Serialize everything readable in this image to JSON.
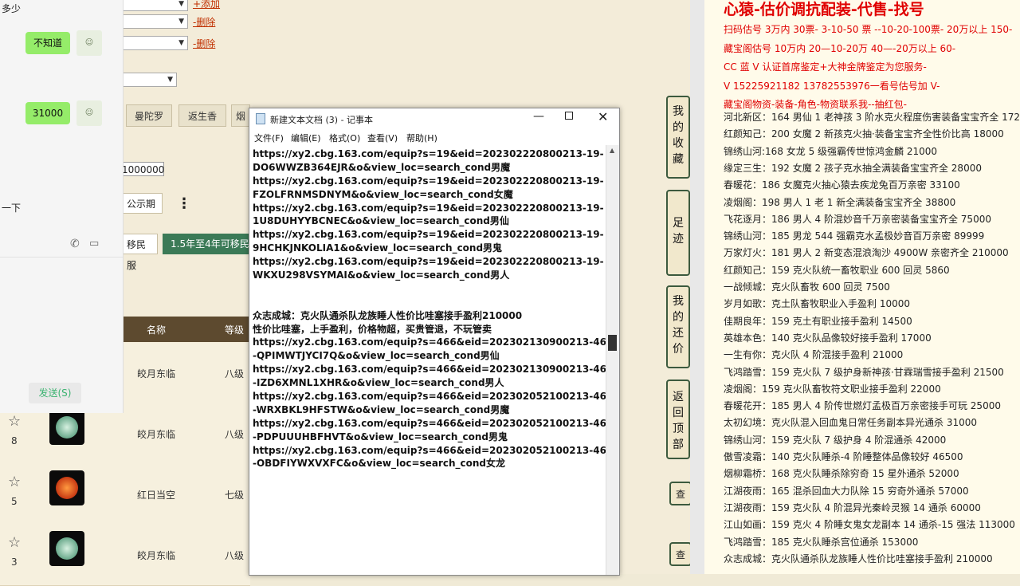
{
  "chat": {
    "top_text": "多少",
    "bubble1": "不知道",
    "bubble2": "31000",
    "left_text": "一下",
    "send_label": "发送(S)"
  },
  "game": {
    "add_link": "+添加",
    "delete1": "-删除",
    "delete2": "-删除",
    "btn_mantuoluo": "曼陀罗",
    "btn_fansheng": "返生香",
    "btn_partial": "烟",
    "price_value": "1000000",
    "public_period": "公示期",
    "migrate_label": "移民服",
    "migrate_tag": "1.5年至4年可移民",
    "col_name": "名称",
    "col_level": "等级",
    "rows": [
      {
        "idx": "",
        "name": "皎月东临",
        "level": "八级"
      },
      {
        "idx": "8",
        "name": "皎月东临",
        "level": "八级"
      },
      {
        "idx": "5",
        "name": "红日当空",
        "level": "七级"
      },
      {
        "idx": "3",
        "name": "皎月东临",
        "level": "八级"
      }
    ],
    "side_nav": [
      "我的收藏",
      "足迹",
      "我的还价",
      "返回顶部"
    ],
    "search_partial": "查"
  },
  "notepad": {
    "title": "新建文本文档 (3) - 记事本",
    "menu": [
      "文件(F)",
      "编辑(E)",
      "格式(O)",
      "查看(V)",
      "帮助(H)"
    ],
    "lines": [
      "https://xy2.cbg.163.com/equip?s=19&eid=202302220800213-19-",
      "DO6WWZB364EJR&o&view_loc=search_cond男魔",
      "https://xy2.cbg.163.com/equip?s=19&eid=202302220800213-19-",
      "FZOLFRNMSDNYM&o&view_loc=search_cond女魔",
      "https://xy2.cbg.163.com/equip?s=19&eid=202302220800213-19-",
      "1U8DUHYYBCNEC&o&view_loc=search_cond男仙",
      "https://xy2.cbg.163.com/equip?s=19&eid=202302220800213-19-",
      "9HCHKJNKOLIA1&o&view_loc=search_cond男鬼",
      "https://xy2.cbg.163.com/equip?s=19&eid=202302220800213-19-",
      "WKXU298VSYMAI&o&view_loc=search_cond男人",
      "",
      "",
      "众志成城：克火队通杀队龙族睡人性价比哇塞接手盈利210000",
      "性价比哇塞，上手盈利，价格物超，买贵管退，不玩管卖",
      "https://xy2.cbg.163.com/equip?s=466&eid=202302130900213-466",
      "-QPIMWTJYCI7Q&o&view_loc=search_cond男仙",
      "https://xy2.cbg.163.com/equip?s=466&eid=202302130900213-466",
      "-IZD6XMNL1XHR&o&view_loc=search_cond男人",
      "https://xy2.cbg.163.com/equip?s=466&eid=202302052100213-466",
      "-WRXBKL9HFSTW&o&view_loc=search_cond男魔",
      "https://xy2.cbg.163.com/equip?s=466&eid=202302052100213-466",
      "-PDPUUUHBFHVT&o&view_loc=search_cond男鬼",
      "https://xy2.cbg.163.com/equip?s=466&eid=202302052100213-466",
      "-OBDFIYWXVXFC&o&view_loc=search_cond女龙"
    ]
  },
  "right_panel": {
    "heading": "心猿-估价调抗配装-代售-找号",
    "red_lines": [
      "扫码估号 3万内 30票- 3-10-50 票  --10-20-100票- 20万以上 150-",
      "藏宝阁估号 10万内 20—10-20万 40—-20万以上 60-",
      "CC 蓝 V 认证首席鉴定+大神金牌鉴定为您服务-",
      "V 15225921182     13782553976一看号估号加 V-",
      "藏宝阁物资-装备-角色-物资联系我--抽红包-"
    ],
    "listings": [
      "河北新区：164 男仙 1 老神孩 3 阶水克火程度伤害装备宝宝齐全 17200",
      "红颜知己：200 女魔 2 新孩克火抽·装备宝宝齐全性价比高 18000",
      "锦绣山河:168 女龙 5 级强霸传世惊鸿金麟 21000",
      "缘定三生：192 女魔 2 孩子克水抽全满装备宝宝齐全 28000",
      "春暖花：186 女魔克火抽心猿去疾龙兔百万亲密 33100",
      "凌烟阁：198 男人 1 老 1 新全满装备宝宝齐全 38800",
      "飞花逐月：186 男人 4 阶混妙音千万亲密装备宝宝齐全 75000",
      "锦绣山河：185 男龙 544 强霸克水孟极妙音百万亲密 89999",
      "万家灯火：181 男人 2 新变态混浪淘沙 4900W 亲密齐全 210000",
      "红颜知己：159 克火队统一畜牧职业 600 回灵 5860",
      "一战倾城：克火队畜牧 600 回灵 7500",
      "岁月如歌：克土队畜牧职业入手盈利 10000",
      "佳期良年：159 克土有职业接手盈利 14500",
      "英雄本色：140 克火队品像较好接手盈利 17000",
      "一生有你：克火队 4 阶混接手盈利 21000",
      "飞鸿踏雪：159 克火队 7 级护身新神孩·甘霖瑞雪接手盈利 21500",
      "凌烟阁：159 克火队畜牧符文职业接手盈利 22000",
      "春暖花开：185 男人 4 阶传世燃灯孟极百万亲密接手可玩 25000",
      "太初幻境：克火队混入回血鬼日常任务副本异光通杀 31000",
      "锦绣山河：159 克火队 7 级护身 4 阶混通杀 42000",
      "傲雪凌霜：140 克火队睡杀-4 阶睡整体品像较好 46500",
      "烟柳霜桥：168 克火队睡杀除穷奇 15 星外通杀 52000",
      "江湖夜雨：165 混杀回血大力队除 15 穷奇外通杀 57000",
      "江湖夜雨：159 克火队 4 阶混异光秦岭灵猴 14 通杀 60000",
      "江山如画：159 克火 4 阶睡女鬼女龙副本 14 通杀-15 强法 113000",
      "飞鸿踏雪：185 克火队睡杀宫位通杀 153000",
      "众志成城：克火队通杀队龙族睡人性价比哇塞接手盈利 210000"
    ]
  }
}
